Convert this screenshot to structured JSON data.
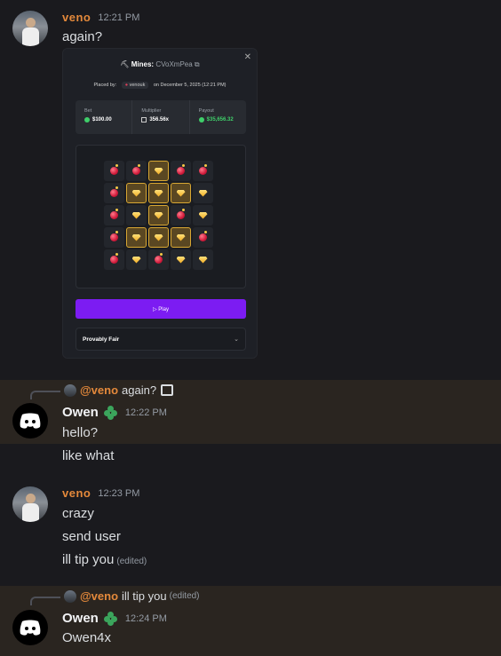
{
  "messages": [
    {
      "author": "veno",
      "time": "12:21 PM",
      "text": "again?"
    },
    {
      "author": "Owen",
      "time": "12:22 PM",
      "reply_to": {
        "author": "@veno",
        "text": "again?"
      },
      "lines": [
        "hello?",
        "like what"
      ]
    },
    {
      "author": "veno",
      "time": "12:23 PM",
      "lines": [
        "crazy",
        "send user",
        "ill tip you"
      ],
      "edited": "(edited)"
    },
    {
      "author": "Owen",
      "time": "12:24 PM",
      "reply_to": {
        "author": "@veno",
        "text": "ill tip you",
        "edited": "(edited)"
      },
      "lines": [
        "Owen4x"
      ]
    }
  ],
  "embed": {
    "game": "Mines:",
    "game_id": "CVoXmPea",
    "placed_by_label": "Placed by:",
    "placed_by_user": "venouk",
    "placed_on": "on December 5, 2025 (12:21 PM)",
    "stats": [
      {
        "label": "Bet",
        "value": "$100.00"
      },
      {
        "label": "Multiplier",
        "value": "356.56x"
      },
      {
        "label": "Payout",
        "value": "$35,656.32"
      }
    ],
    "grid": [
      [
        "bomb",
        "bomb",
        "gem-sel",
        "bomb",
        "bomb"
      ],
      [
        "bomb",
        "gem-sel",
        "gem-sel",
        "gem-sel",
        "gem"
      ],
      [
        "bomb",
        "gem",
        "gem-sel",
        "bomb",
        "gem"
      ],
      [
        "bomb",
        "gem-sel",
        "gem-sel",
        "gem-sel",
        "bomb"
      ],
      [
        "bomb",
        "gem",
        "bomb",
        "gem",
        "gem"
      ]
    ],
    "play_label": "▷ Play",
    "fair_label": "Provably Fair"
  },
  "colors": {
    "veno": "#e4893b",
    "accent": "#7c1cf2",
    "highlight": "#2a2520"
  }
}
